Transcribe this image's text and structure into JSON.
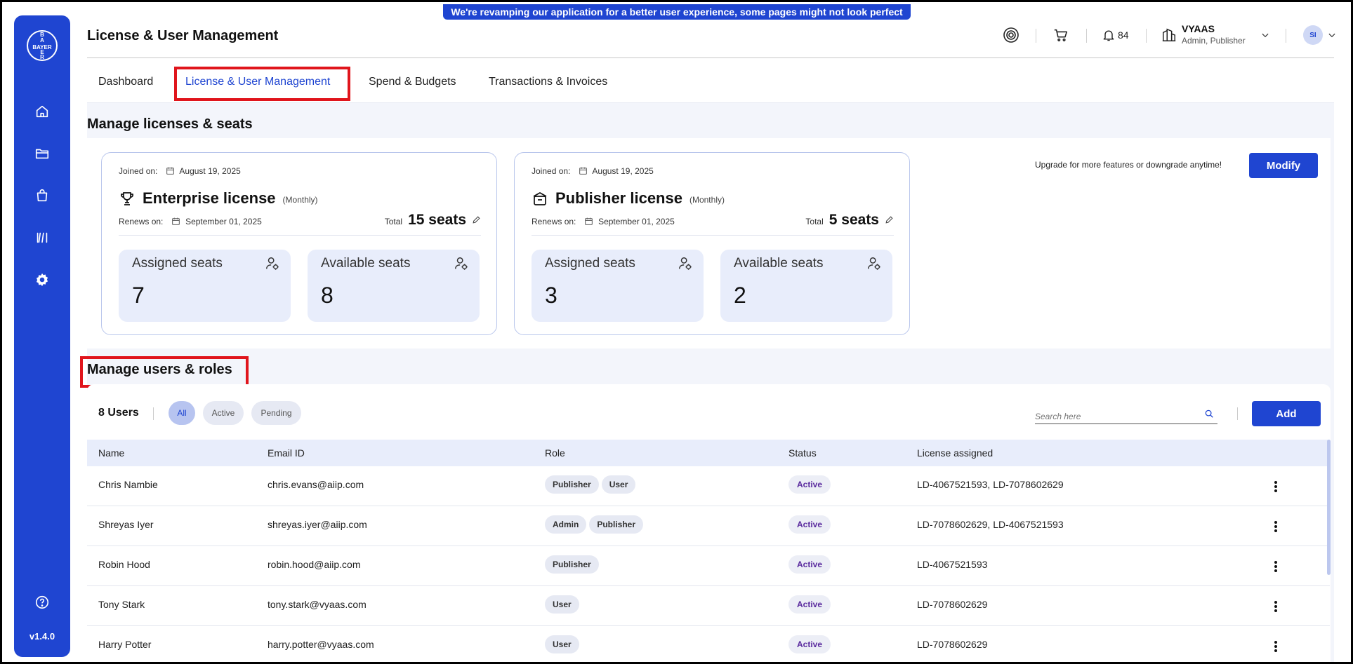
{
  "banner": "We're revamping our application for a better user experience, some pages might not look perfect yet!",
  "sidebar": {
    "logo_vertical": [
      "B",
      "A",
      "Y",
      "E",
      "R"
    ],
    "logo_horizontal": "BAYER",
    "version": "v1.4.0",
    "items": [
      {
        "name": "home",
        "icon": "home-icon"
      },
      {
        "name": "folders",
        "icon": "folder-icon"
      },
      {
        "name": "store",
        "icon": "bag-icon"
      },
      {
        "name": "library",
        "icon": "library-icon"
      },
      {
        "name": "settings",
        "icon": "gear-icon",
        "active": true
      },
      {
        "name": "help",
        "icon": "help-icon"
      }
    ]
  },
  "header": {
    "title": "License & User Management",
    "notification_count": "84",
    "org_name": "VYAAS",
    "org_role": "Admin, Publisher",
    "avatar_initials": "SI"
  },
  "tabs": [
    {
      "label": "Dashboard"
    },
    {
      "label": "License & User Management",
      "active": true
    },
    {
      "label": "Spend & Budgets"
    },
    {
      "label": "Transactions & Invoices"
    }
  ],
  "licenses": {
    "section_title": "Manage licenses & seats",
    "upgrade_text": "Upgrade for more features or downgrade anytime!",
    "modify_label": "Modify",
    "cards": [
      {
        "joined_label": "Joined on:",
        "joined_date": "August 19, 2025",
        "title": "Enterprise license",
        "period": "(Monthly)",
        "renews_label": "Renews on:",
        "renews_date": "September 01, 2025",
        "total_label": "Total",
        "total_seats": "15 seats",
        "assigned_label": "Assigned seats",
        "assigned": "7",
        "available_label": "Available seats",
        "available": "8"
      },
      {
        "joined_label": "Joined on:",
        "joined_date": "August 19, 2025",
        "title": "Publisher license",
        "period": "(Monthly)",
        "renews_label": "Renews on:",
        "renews_date": "September 01, 2025",
        "total_label": "Total",
        "total_seats": "5 seats",
        "assigned_label": "Assigned seats",
        "assigned": "3",
        "available_label": "Available seats",
        "available": "2"
      }
    ]
  },
  "users": {
    "section_title": "Manage users & roles",
    "count_label": "8 Users",
    "filters": [
      {
        "label": "All",
        "selected": true
      },
      {
        "label": "Active"
      },
      {
        "label": "Pending"
      }
    ],
    "search_placeholder": "Search here",
    "add_label": "Add",
    "columns": [
      "Name",
      "Email ID",
      "Role",
      "Status",
      "License assigned"
    ],
    "rows": [
      {
        "name": "Chris Nambie",
        "email": "chris.evans@aiip.com",
        "roles": [
          "Publisher",
          "User"
        ],
        "status": "Active",
        "license": "LD-4067521593, LD-7078602629"
      },
      {
        "name": "Shreyas Iyer",
        "email": "shreyas.iyer@aiip.com",
        "roles": [
          "Admin",
          "Publisher"
        ],
        "status": "Active",
        "license": "LD-7078602629, LD-4067521593"
      },
      {
        "name": "Robin Hood",
        "email": "robin.hood@aiip.com",
        "roles": [
          "Publisher"
        ],
        "status": "Active",
        "license": "LD-4067521593"
      },
      {
        "name": "Tony Stark",
        "email": "tony.stark@vyaas.com",
        "roles": [
          "User"
        ],
        "status": "Active",
        "license": "LD-7078602629"
      },
      {
        "name": "Harry Potter",
        "email": "harry.potter@vyaas.com",
        "roles": [
          "User"
        ],
        "status": "Active",
        "license": "LD-7078602629"
      }
    ]
  },
  "colors": {
    "accent": "#1f45d1",
    "highlight": "#e0151c",
    "status_text": "#5a2a9e"
  }
}
